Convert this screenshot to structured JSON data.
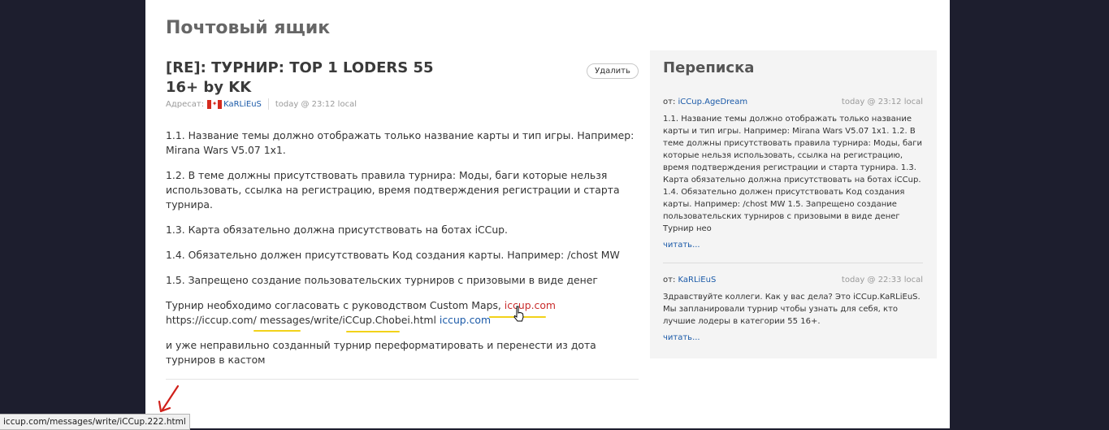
{
  "page": {
    "title": "Почтовый ящик"
  },
  "message": {
    "subject": "[RE]: ТУРНИР: TOP 1 LODERS 55 16+ by KK",
    "delete_label": "Удалить",
    "recipient_label": "Адресат:",
    "recipient_name": "KaRLiEuS",
    "date": "today @ 23:12 local",
    "paragraphs": [
      "1.1. Название темы должно отображать только название карты и тип игры. Например: Mirana Wars V5.07 1x1.",
      "1.2. В теме должны присутствовать правила турнира: Моды, баги которые нельзя использовать, ссылка на регистрацию, время подтверждения регистрации и старта турнира.",
      "1.3. Карта обязательно должна присутствовать на ботах iCCup.",
      "1.4. Обязательно должен присутствовать Код создания карты. Например: /chost MW",
      "1.5. Запрещено создание пользовательских турниров с призовыми в виде денег"
    ],
    "p6_text": "Турнир необходимо согласовать с руководством Custom Maps, ",
    "p6_link1": "iccup.com",
    "p6_url": " https://iccup.com/ messages/write/iCCup.Chobei.html ",
    "p6_link2": "iccup.com",
    "p7": "и уже неправильно созданный турнир переформатировать и перенести из дота турниров в кастом"
  },
  "sidebar": {
    "title": "Переписка",
    "conversations": [
      {
        "from_label": "от:",
        "from": "iCCup.AgeDream",
        "date": "today @ 23:12 local",
        "text": "1.1. Название темы должно отображать только название карты и тип игры. Например: Mirana Wars V5.07 1x1. 1.2. В теме должны присутствовать правила турнира: Моды, баги которые нельзя использовать, ссылка на регистрацию, время подтверждения регистрации и старта турнира. 1.3. Карта обязательно должна присутствовать на ботах iCCup. 1.4. Обязательно должен присутствовать Код создания карты. Например: /chost MW 1.5. Запрещено создание пользовательских турниров с призовыми в виде денег Турнир нео",
        "more": "читать..."
      },
      {
        "from_label": "от:",
        "from": "KaRLiEuS",
        "date": "today @ 22:33 local",
        "text": "Здравствуйте коллеги. Как у вас дела? Это iCCup.KaRLiEuS. Мы запланировали турнир чтобы узнать для себя, кто лучшие лодеры в категории 55 16+.",
        "more": "читать..."
      }
    ]
  },
  "status_bar": {
    "url": "iccup.com/messages/write/iCCup.222.html"
  },
  "colors": {
    "link": "#1b5aa8",
    "highlight_link": "#c92c2c",
    "annotation": "#f2d21a",
    "arrow": "#d0201a"
  },
  "icons": [
    "canada-flag-icon",
    "hand-cursor-icon",
    "annotation-arrow-icon"
  ]
}
